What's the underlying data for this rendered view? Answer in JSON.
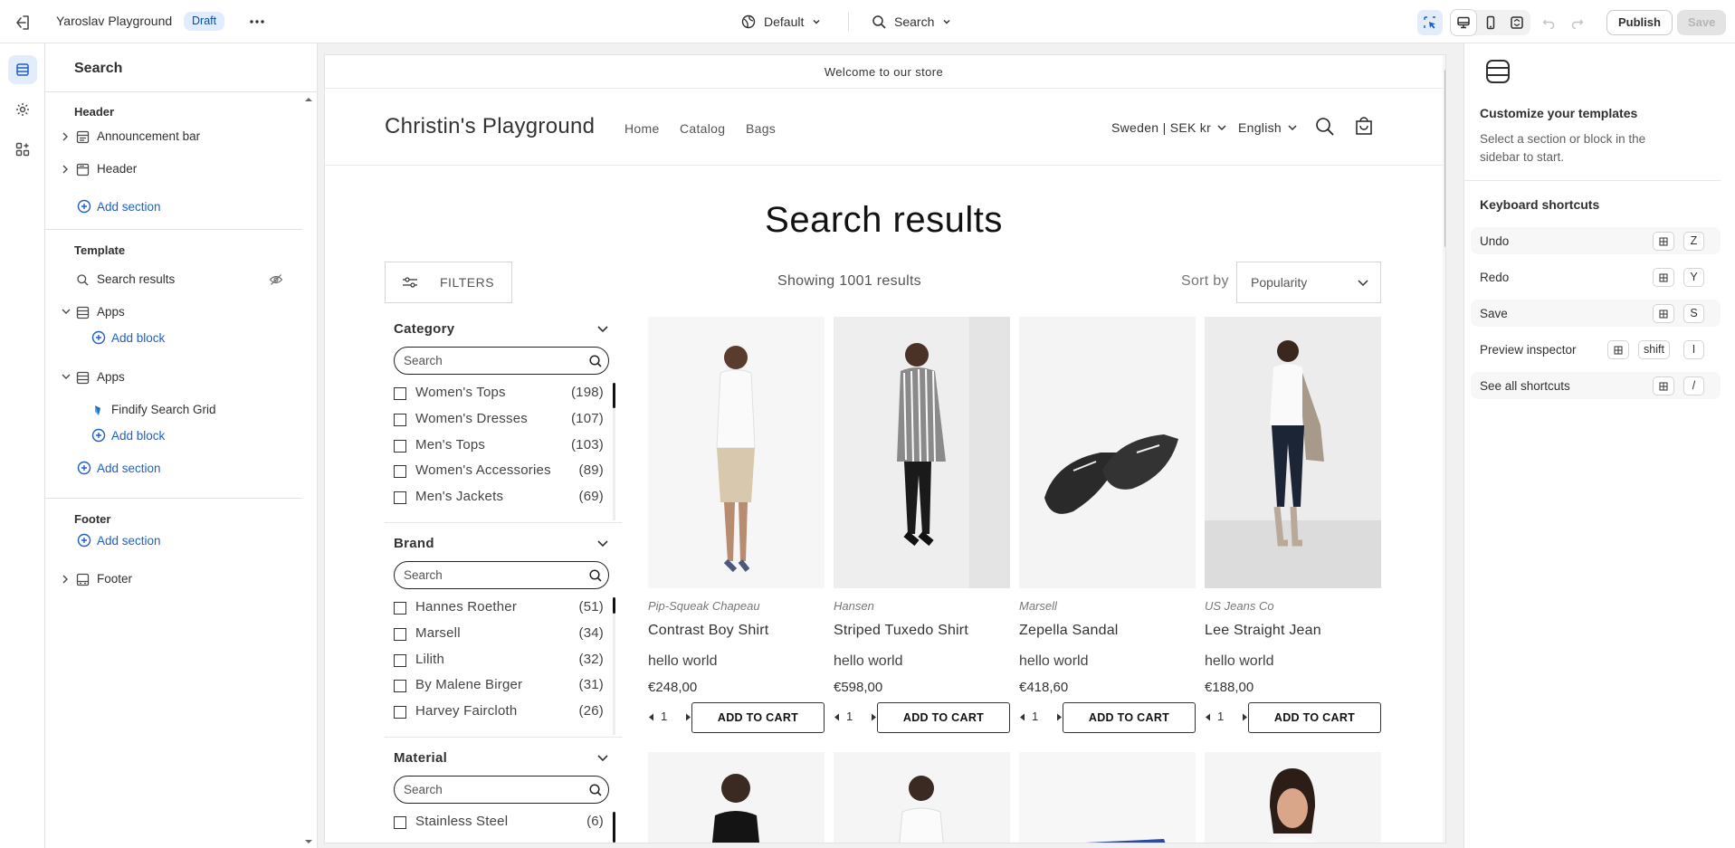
{
  "topbar": {
    "store_name": "Yaroslav Playground",
    "status_badge": "Draft",
    "theme_selector": "Default",
    "page_selector": "Search",
    "publish_label": "Publish",
    "save_label": "Save"
  },
  "left_panel": {
    "title": "Search",
    "groups": {
      "header": "Header",
      "template": "Template",
      "footer": "Footer"
    },
    "header_items": [
      "Announcement bar",
      "Header"
    ],
    "template_items": {
      "search_results": "Search results",
      "apps1": "Apps",
      "apps2": "Apps",
      "findify": "Findify Search Grid"
    },
    "footer_item": "Footer",
    "add_section": "Add section",
    "add_block": "Add block"
  },
  "preview": {
    "announcement": "Welcome to our store",
    "logo": "Christin's Playground",
    "nav": [
      "Home",
      "Catalog",
      "Bags"
    ],
    "country": "Sweden | SEK kr",
    "language": "English",
    "heading": "Search results",
    "filters_label": "FILTERS",
    "showing": "Showing 1001 results",
    "sort_label": "Sort by",
    "sort_value": "Popularity",
    "search_placeholder": "Search",
    "facets": [
      {
        "title": "Category",
        "options": [
          {
            "name": "Women's Tops",
            "count": "(198)"
          },
          {
            "name": "Women's Dresses",
            "count": "(107)"
          },
          {
            "name": "Men's Tops",
            "count": "(103)"
          },
          {
            "name": "Women's Accessories",
            "count": "(89)"
          },
          {
            "name": "Men's Jackets",
            "count": "(69)"
          }
        ]
      },
      {
        "title": "Brand",
        "options": [
          {
            "name": "Hannes Roether",
            "count": "(51)"
          },
          {
            "name": "Marsell",
            "count": "(34)"
          },
          {
            "name": "Lilith",
            "count": "(32)"
          },
          {
            "name": "By Malene Birger",
            "count": "(31)"
          },
          {
            "name": "Harvey Faircloth",
            "count": "(26)"
          }
        ]
      },
      {
        "title": "Material",
        "options": [
          {
            "name": "Stainless Steel",
            "count": "(6)"
          }
        ]
      }
    ],
    "products": [
      {
        "vendor": "Pip-Squeak Chapeau",
        "title": "Contrast Boy Shirt",
        "desc": "hello world",
        "price": "€248,00",
        "qty": "1",
        "cta": "ADD TO CART"
      },
      {
        "vendor": "Hansen",
        "title": "Striped Tuxedo Shirt",
        "desc": "hello world",
        "price": "€598,00",
        "qty": "1",
        "cta": "ADD TO CART"
      },
      {
        "vendor": "Marsell",
        "title": "Zepella Sandal",
        "desc": "hello world",
        "price": "€418,60",
        "qty": "1",
        "cta": "ADD TO CART"
      },
      {
        "vendor": "US Jeans Co",
        "title": "Lee Straight Jean",
        "desc": "hello world",
        "price": "€188,00",
        "qty": "1",
        "cta": "ADD TO CART"
      }
    ]
  },
  "right_panel": {
    "heading": "Customize your templates",
    "body": "Select a section or block in the sidebar to start.",
    "shortcuts_title": "Keyboard shortcuts",
    "shortcuts": [
      {
        "label": "Undo",
        "keys": [
          "Z"
        ]
      },
      {
        "label": "Redo",
        "keys": [
          "Y"
        ]
      },
      {
        "label": "Save",
        "keys": [
          "S"
        ]
      },
      {
        "label": "Preview inspector",
        "keys": [
          "shift",
          "I"
        ]
      },
      {
        "label": "See all shortcuts",
        "keys": [
          "/"
        ]
      }
    ]
  },
  "colors": {
    "accent": "#1f5fc4",
    "draft_bg": "#e0ecff",
    "draft_text": "#0a4d9e"
  }
}
